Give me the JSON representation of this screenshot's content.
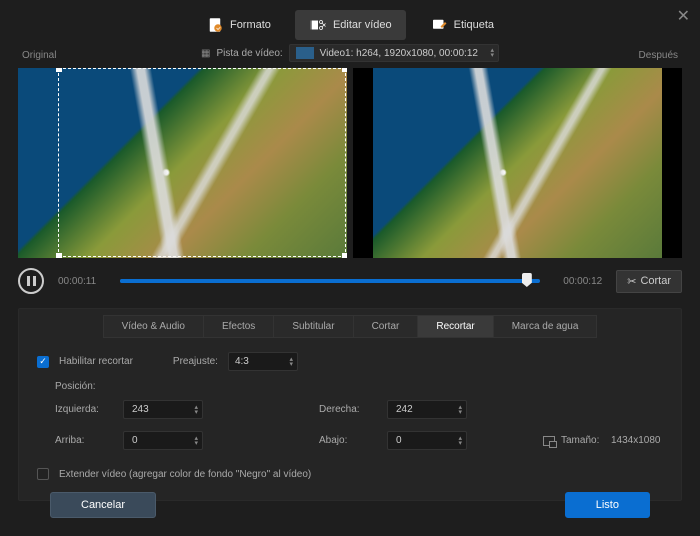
{
  "close_icon": "✕",
  "top_tabs": {
    "formato": "Formato",
    "editar": "Editar vídeo",
    "etiqueta": "Etiqueta"
  },
  "track": {
    "label": "Pista de vídeo:",
    "value": "Video1: h264, 1920x1080, 00:00:12"
  },
  "preview": {
    "original": "Original",
    "despues": "Después"
  },
  "playback": {
    "current": "00:00:11",
    "total": "00:00:12",
    "cut_label": "Cortar"
  },
  "sub_tabs": {
    "video_audio": "Vídeo & Audio",
    "efectos": "Efectos",
    "subtitular": "Subtitular",
    "cortar": "Cortar",
    "recortar": "Recortar",
    "marca": "Marca de agua"
  },
  "crop": {
    "enable_label": "Habilitar recortar",
    "preset_label": "Preajuste:",
    "preset_value": "4:3",
    "position_label": "Posición:",
    "left_label": "Izquierda:",
    "left_value": "243",
    "right_label": "Derecha:",
    "right_value": "242",
    "top_label": "Arriba:",
    "top_value": "0",
    "bottom_label": "Abajo:",
    "bottom_value": "0",
    "size_label": "Tamaño:",
    "size_value": "1434x1080",
    "extend_label": "Extender vídeo (agregar color de fondo \"Negro\" al vídeo)"
  },
  "footer": {
    "cancel": "Cancelar",
    "ok": "Listo"
  }
}
